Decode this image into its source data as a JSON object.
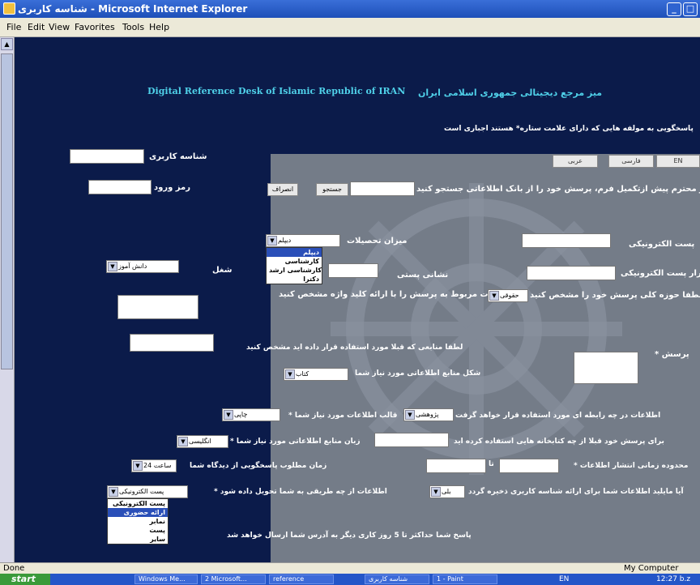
{
  "window": {
    "title": "شناسه کاربری - Microsoft Internet Explorer",
    "min_label": "_",
    "max_label": "□"
  },
  "menu": [
    "File",
    "Edit",
    "View",
    "Favorites",
    "Tools",
    "Help"
  ],
  "header": {
    "english_title": "Digital Reference Desk  of  Islamic Republic of  IRAN",
    "persian_title": "میز مرجع دیجیتالی  جمهوری اسلامی ایران",
    "required_note": "پاسخگویی به مولفه هایی که دارای علامت ستاره* هستند اجباری است"
  },
  "lang_tabs": [
    "عربی",
    "فارسی",
    "EN"
  ],
  "login": {
    "user_label": "شناسه کاربری",
    "pass_label": "رمز ورود"
  },
  "search": {
    "prompt": "کاربر محترم پیش ازتکمیل فرم، پرسش خود را از بانک اطلاعاتی جستجو کنید",
    "search_button": "جستجو",
    "cancel_button": "انصراف"
  },
  "education": {
    "label": "میزان تحصیلات",
    "selected": "دیپلم",
    "options": [
      "دیپلم",
      "کارشناسی",
      "کارشناسی ارشد",
      "دکترا"
    ]
  },
  "email_label": "پست الکترونیکی",
  "email_repeat_label": "تکرار پست الکترونیکی",
  "postal_label": "نشانی پستی",
  "job": {
    "label": "شغل",
    "selected": "دانش آموز"
  },
  "subject": {
    "label": "لطفا حوزه کلی پرسش خود را مشخص کنید",
    "selected": "حقوقی",
    "details_label": "جزئیات مربوط به پرسش را با ارائه کلید واژه مشخص کنید"
  },
  "question_label": "* پرسش",
  "used_sources_label": "لطفا منابعی که قبلا مورد استفاده قرار داده اید مشخص کنید",
  "source_format": {
    "label": "شکل منابع اطلاعاتی مورد نیاز شما",
    "selected": "کتاب"
  },
  "usage": {
    "label": "اطلاعات در چه رابطه ای مورد استفاده قرار خواهد گرفت",
    "selected": "پژوهشی",
    "format_label": "* قالب اطلاعات مورد نیاز شما",
    "format_selected": "چاپی"
  },
  "libraries_label": "برای پرسش خود قبلا از چه کتابخانه هایی استفاده کرده اید",
  "language": {
    "label": "* زبان منابع اطلاعاتی مورد نیاز شما",
    "selected": "انگلیسی"
  },
  "time_limit_label": "* محدوده زمانی انتشار اطلاعات",
  "time_to": "تا",
  "response_time": {
    "label": "زمان مطلوب پاسخگویی از دیدگاه شما",
    "selected": "24 ساعت"
  },
  "save": {
    "label": "آیا مایلید اطلاعات شما برای ارائه شناسه کاربری ذخیره گردد",
    "selected": "بلی"
  },
  "delivery": {
    "label": "* اطلاعات از چه طریقی به شما تحویل داده شود",
    "selected": "پست الکترونیکی",
    "options": [
      "پست الکترونیکی",
      "ارائه حضوری",
      "نمابر",
      "پست",
      "سایر"
    ]
  },
  "footer_note": "پاسخ شما حداکثر تا 5 روز کاری دیگر به آدرس شما ارسال خواهد شد",
  "status": {
    "left": "Done",
    "right": "My Computer"
  },
  "taskbar": {
    "start": "start",
    "items": [
      "Windows Me...",
      "2 Microsoft...",
      "reference",
      "شناسه کاربری",
      "1 - Paint"
    ],
    "lang": "EN",
    "clock": "12:27 b.z"
  },
  "colors": {
    "page_bg": "#0b1b4a",
    "panel_bg": "#747c88",
    "title_cyan": "#4fd0e8"
  }
}
